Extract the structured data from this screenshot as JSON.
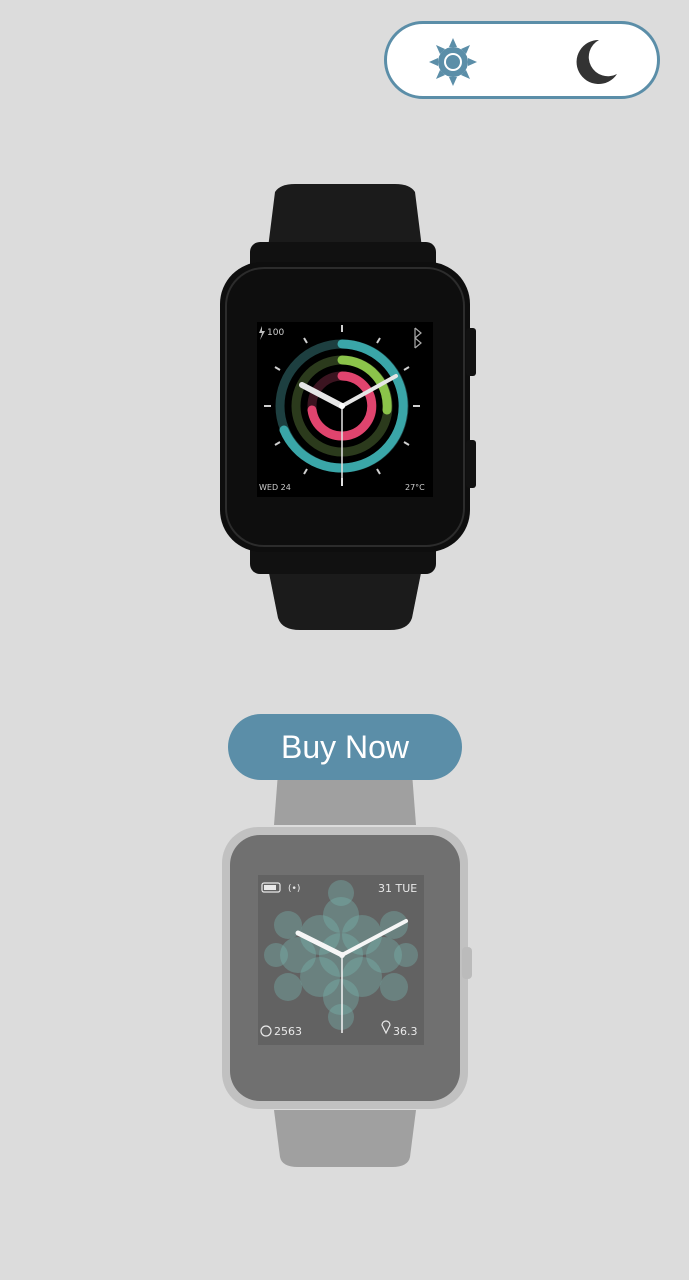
{
  "theme_toggle": {
    "light_icon": "sun-icon",
    "dark_icon": "moon-icon",
    "accent_color": "#5b8ea8"
  },
  "watch_dark": {
    "battery": "100",
    "date": "WED 24",
    "temperature": "27°C",
    "ring_colors": [
      "#3aa6a8",
      "#8bc34a",
      "#e0446e"
    ]
  },
  "buy_button": {
    "label": "Buy Now"
  },
  "watch_light": {
    "date": "31 TUE",
    "steps": "2563",
    "distance": "36.3"
  }
}
